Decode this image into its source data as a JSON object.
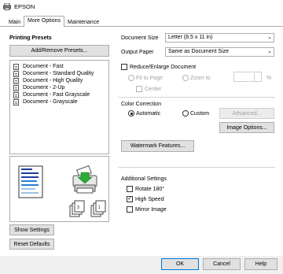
{
  "window": {
    "title": "EPSON"
  },
  "tabs": [
    "Main",
    "More Options",
    "Maintenance"
  ],
  "presets": {
    "heading": "Printing Presets",
    "add_remove_label": "Add/Remove Presets...",
    "items": [
      "Document - Fast",
      "Document - Standard Quality",
      "Document - High Quality",
      "Document - 2-Up",
      "Document - Fast Grayscale",
      "Document - Grayscale"
    ]
  },
  "left_buttons": {
    "show_settings": "Show Settings",
    "reset_defaults": "Reset Defaults"
  },
  "document_size": {
    "label": "Document Size",
    "value": "Letter (8.5 x 11 in)"
  },
  "output_paper": {
    "label": "Output Paper",
    "value": "Same as Document Size"
  },
  "reduce_enlarge": {
    "label": "Reduce/Enlarge Document",
    "fit_to_page": "Fit to Page",
    "zoom_to": "Zoom to",
    "center": "Center",
    "percent": "%"
  },
  "color_correction": {
    "heading": "Color Correction",
    "automatic": "Automatic",
    "custom": "Custom",
    "advanced": "Advanced...",
    "image_options": "Image Options..."
  },
  "watermark_label": "Watermark Features...",
  "additional_settings": {
    "heading": "Additional Settings",
    "rotate": "Rotate 180°",
    "high_speed": "High Speed",
    "mirror_image": "Mirror Image"
  },
  "footer_buttons": {
    "ok": "OK",
    "cancel": "Cancel",
    "help": "Help"
  },
  "glyphs": {
    "check": "✓",
    "dropdown": "⌄"
  }
}
